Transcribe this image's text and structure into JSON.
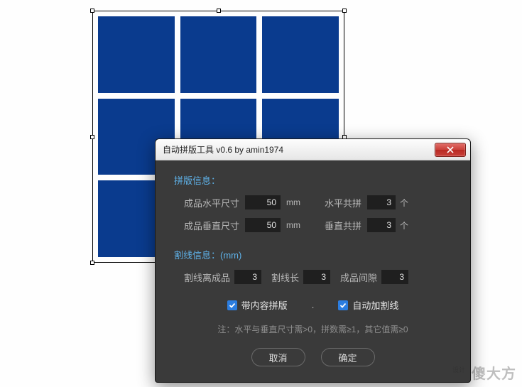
{
  "dialog": {
    "title": "自动拼版工具 v0.6   by amin1974",
    "imposition_section": "拼版信息：",
    "horizontal_size_label": "成品水平尺寸",
    "horizontal_size_value": "50",
    "vertical_size_label": "成品垂直尺寸",
    "vertical_size_value": "50",
    "unit_mm": "mm",
    "horizontal_count_label": "水平共拼",
    "horizontal_count_value": "3",
    "vertical_count_label": "垂直共拼",
    "vertical_count_value": "3",
    "unit_count": "个",
    "cutline_section": "割线信息：(mm)",
    "cutline_offset_label": "割线离成品",
    "cutline_offset_value": "3",
    "cutline_length_label": "割线长",
    "cutline_length_value": "3",
    "product_gap_label": "成品间隙",
    "product_gap_value": "3",
    "checkbox_content": "带内容拼版",
    "checkbox_autocutline": "自动加割线",
    "note": "注：水平与垂直尺寸需>0，拼数需≥1，其它值需≥0",
    "cancel": "取消",
    "confirm": "确定"
  },
  "watermark": {
    "main": "傻大方",
    "sub": "设计"
  },
  "grid": {
    "rows": 3,
    "cols": 3,
    "cell_color": "#0a3b8e"
  }
}
